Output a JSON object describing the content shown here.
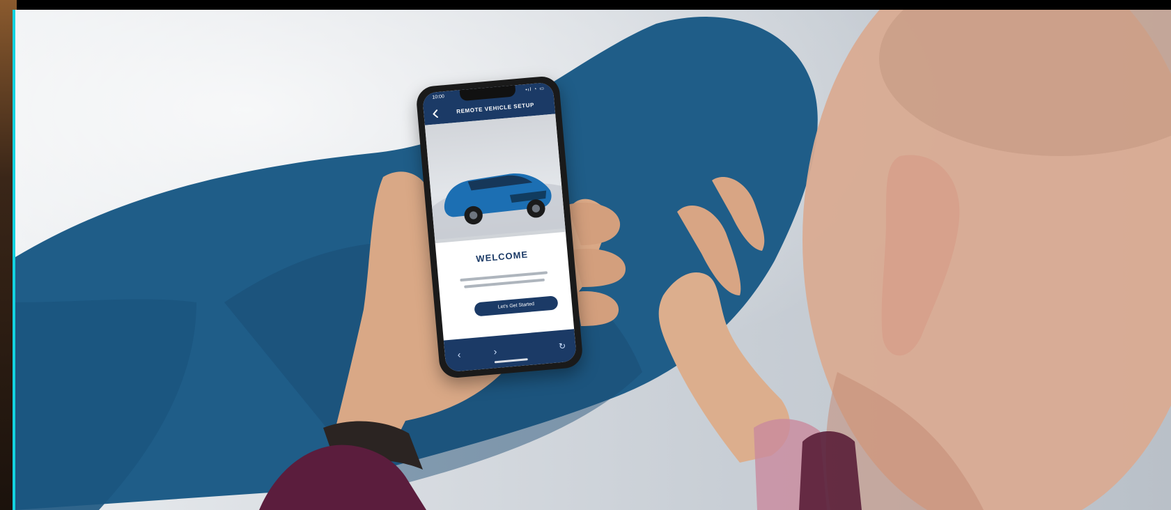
{
  "scene": {
    "colors": {
      "accent_edge": "#13d3e0",
      "jeans": "#1e5b86",
      "skin": "#d6a785",
      "sleeve": "#5b1d3d",
      "ear": "#d8a98f"
    }
  },
  "phone_app": {
    "status": {
      "time": "10:00",
      "signal": "•ıl ◔ ▭"
    },
    "header": {
      "title": "REMOTE VEHICLE SETUP",
      "back_icon": "chevron-left-icon"
    },
    "hero": {
      "car_color": "#1c6fb3"
    },
    "content": {
      "title": "WELCOME"
    },
    "cta": {
      "label": "Let's Get Started"
    },
    "bottom_nav": {
      "prev_icon": "chevron-left-icon",
      "next_icon": "chevron-right-icon",
      "refresh_icon": "refresh-icon"
    }
  }
}
